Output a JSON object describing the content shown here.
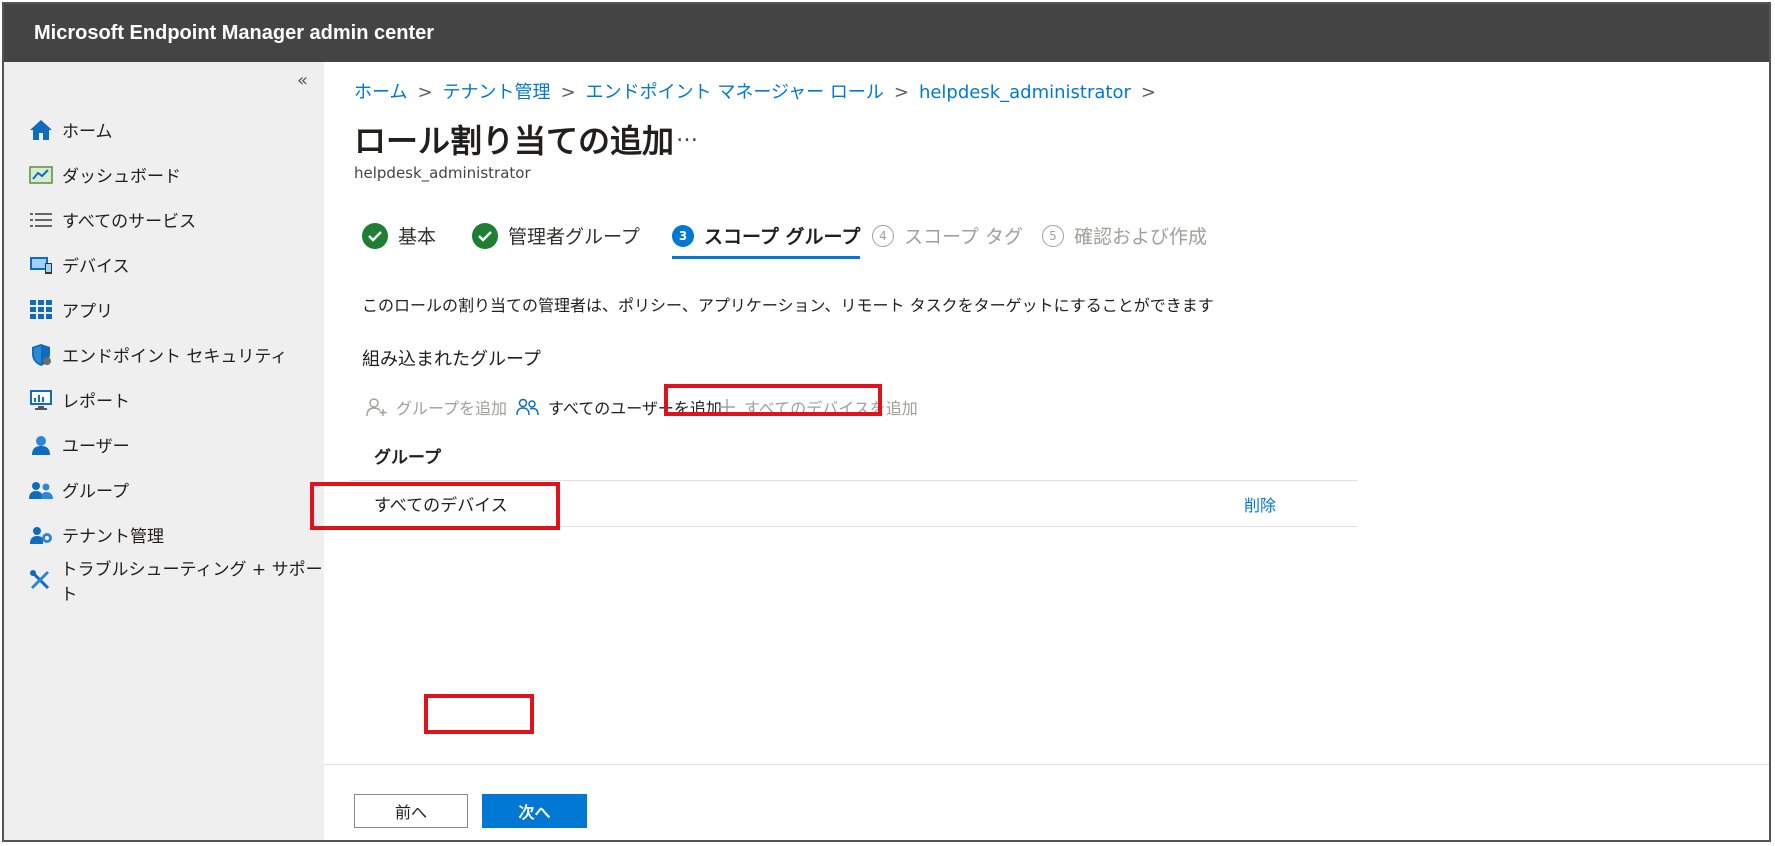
{
  "app": {
    "title": "Microsoft Endpoint Manager admin center"
  },
  "sidebar": {
    "collapse_glyph": "«",
    "items": [
      {
        "label": "ホーム",
        "icon": "home-icon"
      },
      {
        "label": "ダッシュボード",
        "icon": "dashboard-icon"
      },
      {
        "label": "すべてのサービス",
        "icon": "list-icon"
      },
      {
        "label": "デバイス",
        "icon": "device-icon"
      },
      {
        "label": "アプリ",
        "icon": "apps-grid-icon"
      },
      {
        "label": "エンドポイント セキュリティ",
        "icon": "shield-icon"
      },
      {
        "label": "レポート",
        "icon": "report-icon"
      },
      {
        "label": "ユーザー",
        "icon": "user-icon"
      },
      {
        "label": "グループ",
        "icon": "group-icon"
      },
      {
        "label": "テナント管理",
        "icon": "tenant-admin-icon"
      },
      {
        "label": "トラブルシューティング + サポート",
        "icon": "wrench-icon"
      }
    ]
  },
  "breadcrumb": [
    {
      "label": "ホーム"
    },
    {
      "label": "テナント管理"
    },
    {
      "label": "エンドポイント マネージャー ロール"
    },
    {
      "label": "helpdesk_administrator"
    }
  ],
  "breadcrumb_sep": ">",
  "page": {
    "title": "ロール割り当ての追加",
    "more": "…",
    "subtitle": "helpdesk_administrator"
  },
  "wizard": {
    "steps": [
      {
        "label": "基本",
        "state": "done"
      },
      {
        "label": "管理者グループ",
        "state": "done"
      },
      {
        "label": "スコープ グループ",
        "state": "current",
        "number": "3"
      },
      {
        "label": "スコープ タグ",
        "state": "pending",
        "number": "4"
      },
      {
        "label": "確認および作成",
        "state": "pending",
        "number": "5"
      }
    ]
  },
  "content": {
    "description": "このロールの割り当ての管理者は、ポリシー、アプリケーション、リモート タスクをターゲットにすることができます",
    "section_title": "組み込まれたグループ",
    "commands": {
      "add_group": "グループを追加",
      "add_all_users": "すべてのユーザーを追加",
      "add_all_devices": "すべてのデバイスを追加"
    },
    "table": {
      "header": "グループ",
      "rows": [
        {
          "name": "すべてのデバイス",
          "action": "削除"
        }
      ]
    }
  },
  "footer": {
    "prev_label": "前へ",
    "next_label": "次へ"
  },
  "colors": {
    "accent": "#0078d4",
    "highlight": "#e0121c",
    "topbar": "#444444",
    "sidebar": "#efefef",
    "success": "#1e7e34"
  }
}
